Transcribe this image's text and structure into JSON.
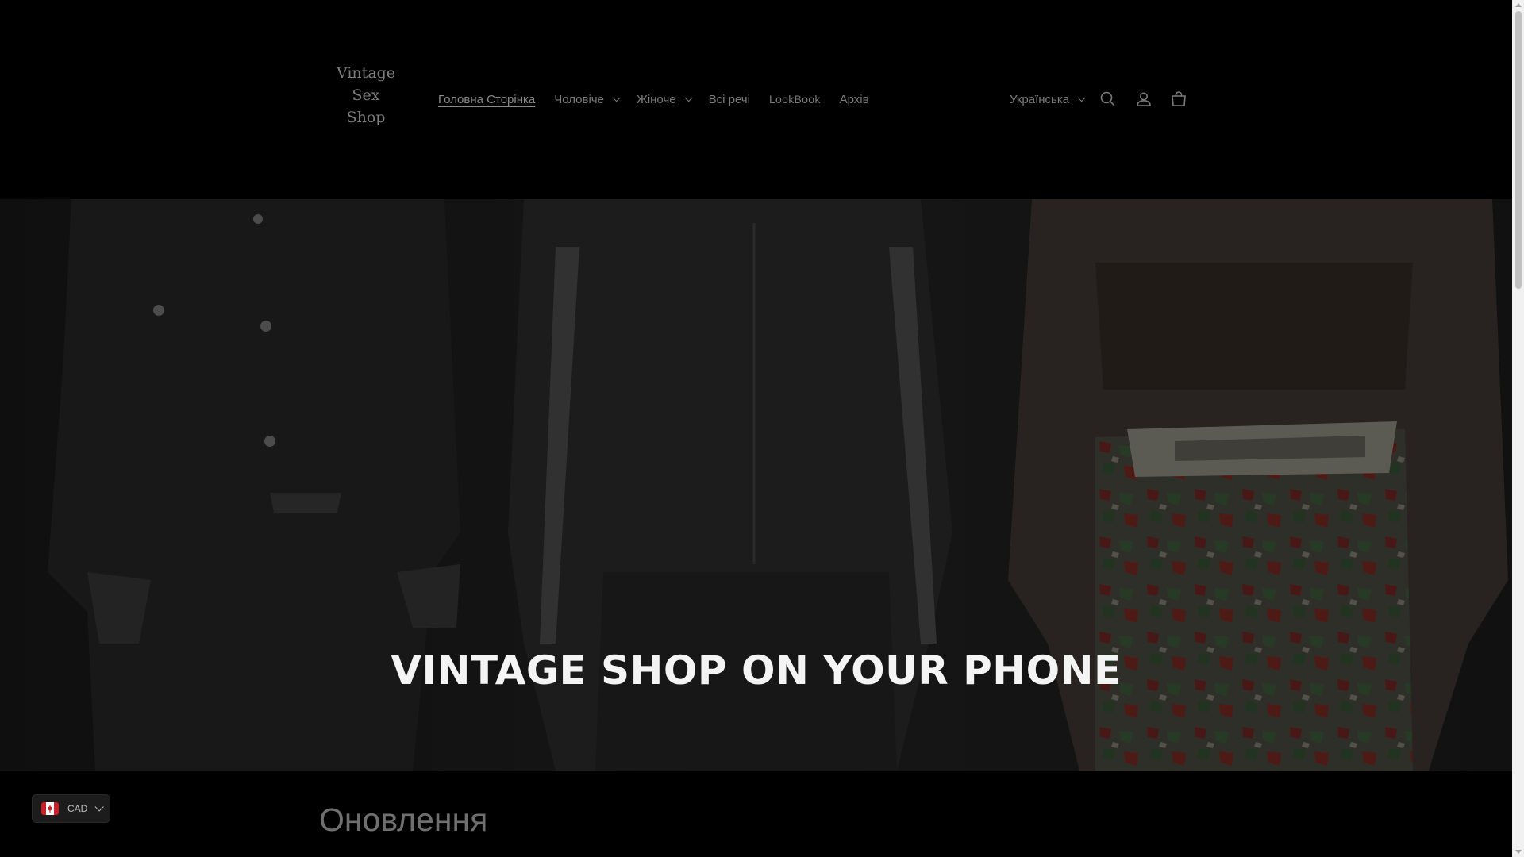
{
  "header": {
    "logo_lines": [
      "Vintage",
      "Sex",
      "Shop"
    ],
    "nav": [
      {
        "label": "Головна Сторінка",
        "active": true
      },
      {
        "label": "Чоловіче",
        "dropdown": true
      },
      {
        "label": "Жіноче",
        "dropdown": true
      },
      {
        "label": "Всі речі"
      },
      {
        "label": "LookBook"
      },
      {
        "label": "Архів"
      }
    ],
    "language": "Українська",
    "icons": [
      "search-icon",
      "account-icon",
      "cart-icon"
    ]
  },
  "hero": {
    "title": "VINTAGE SHOP ON YOUR PHONE"
  },
  "section": {
    "title": "Оновлення"
  },
  "currency": {
    "code": "CAD",
    "flag": "canada-flag-icon"
  },
  "colors": {
    "background": "#000000",
    "hero_text": "#f4f4f4",
    "nav_text": "#7b7b7b"
  }
}
